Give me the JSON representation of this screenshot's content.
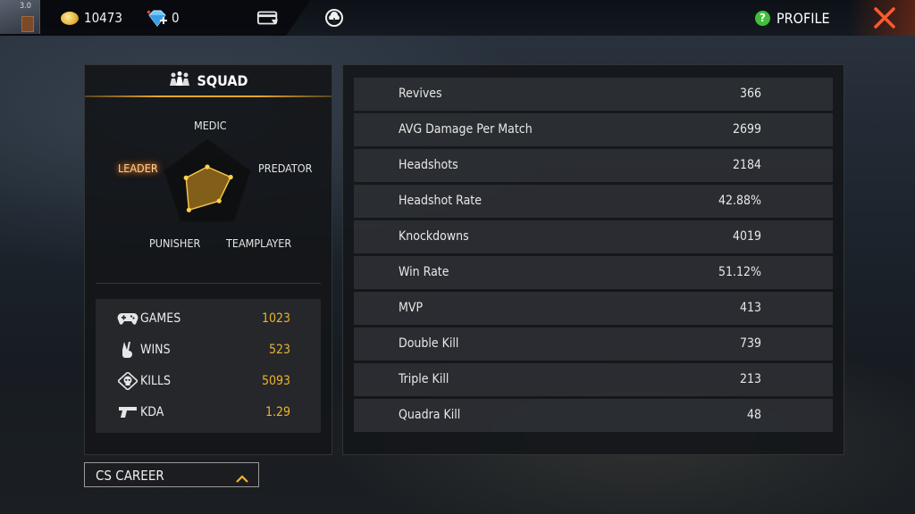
{
  "topbar": {
    "avatar_level": "3.0",
    "coins": "10473",
    "diamonds": "0",
    "profile_label": "PROFILE",
    "help_icon_text": "?"
  },
  "mode": {
    "title": "SQUAD"
  },
  "radar": {
    "axes": [
      "MEDIC",
      "PREDATOR",
      "TEAMPLAYER",
      "PUNISHER",
      "LEADER"
    ],
    "values": [
      0.4,
      0.55,
      0.45,
      0.7,
      0.5
    ],
    "highlighted_axis": "LEADER",
    "fill_color": "#e0a020"
  },
  "summary": [
    {
      "icon": "gamepad-icon",
      "label": "GAMES",
      "value": "1023"
    },
    {
      "icon": "victory-hand-icon",
      "label": "WINS",
      "value": "523"
    },
    {
      "icon": "skull-icon",
      "label": "KILLS",
      "value": "5093"
    },
    {
      "icon": "pistol-icon",
      "label": "KDA",
      "value": "1.29"
    }
  ],
  "career_dropdown": {
    "label": "CS CAREER"
  },
  "stats": [
    {
      "label": "Revives",
      "value": "366"
    },
    {
      "label": "AVG Damage Per Match",
      "value": "2699"
    },
    {
      "label": "Headshots",
      "value": "2184"
    },
    {
      "label": "Headshot Rate",
      "value": "42.88%"
    },
    {
      "label": "Knockdowns",
      "value": "4019"
    },
    {
      "label": "Win Rate",
      "value": "51.12%"
    },
    {
      "label": "MVP",
      "value": "413"
    },
    {
      "label": "Double Kill",
      "value": "739"
    },
    {
      "label": "Triple Kill",
      "value": "213"
    },
    {
      "label": "Quadra Kill",
      "value": "48"
    }
  ],
  "colors": {
    "accent_gold": "#f0b429",
    "close_red": "#ff5a2a",
    "help_green": "#3fbf3a"
  }
}
